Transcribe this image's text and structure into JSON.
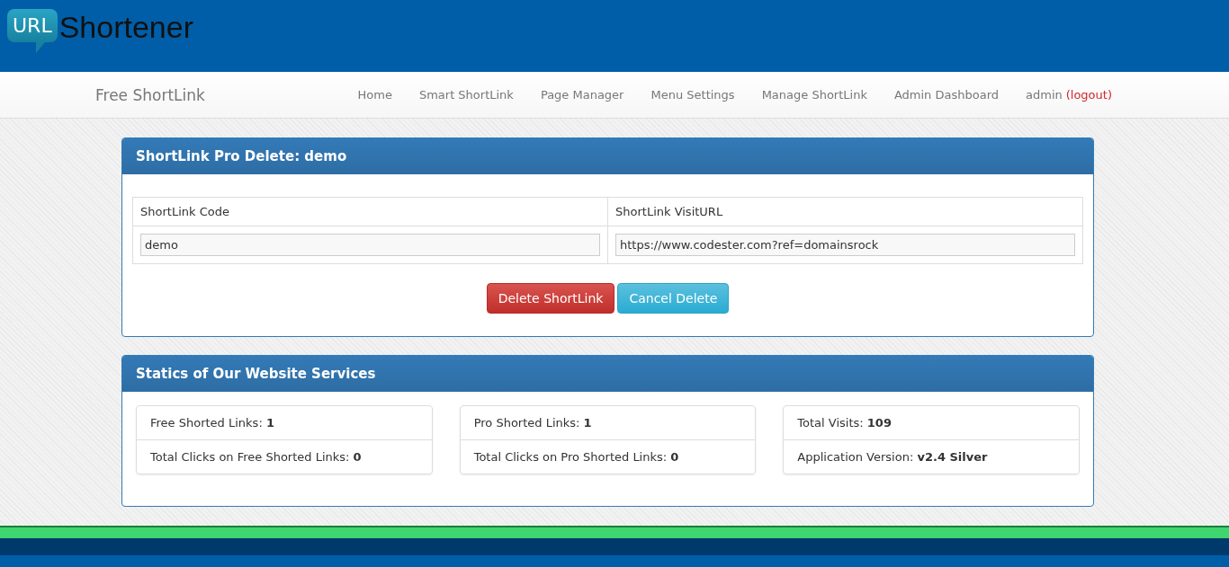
{
  "logo": {
    "badge": "URL",
    "text": "Shortener"
  },
  "navbar": {
    "brand": "Free ShortLink",
    "items": [
      {
        "label": "Home"
      },
      {
        "label": "Smart ShortLink"
      },
      {
        "label": "Page Manager"
      },
      {
        "label": "Menu Settings"
      },
      {
        "label": "Manage ShortLink"
      },
      {
        "label": "Admin Dashboard"
      }
    ],
    "user": {
      "name": "admin",
      "logout": "(logout)"
    }
  },
  "delete_panel": {
    "title": "ShortLink Pro Delete: demo",
    "columns": [
      "ShortLink Code",
      "ShortLink VisitURL"
    ],
    "values": [
      "demo",
      "https://www.codester.com?ref=domainsrock"
    ],
    "buttons": [
      {
        "label": "Delete ShortLink",
        "kind": "danger"
      },
      {
        "label": "Cancel Delete",
        "kind": "info"
      }
    ]
  },
  "stats_panel": {
    "title": "Statics of Our Website Services",
    "groups": [
      [
        "Free Shorted Links: **1**",
        "Total Clicks on Free Shorted Links: **0**"
      ],
      [
        "Pro Shorted Links: **1**",
        "Total Clicks on Pro Shorted Links: **0**"
      ],
      [
        "Total Visits: **109**",
        "Application Version: **v2.4 Silver**"
      ]
    ]
  }
}
